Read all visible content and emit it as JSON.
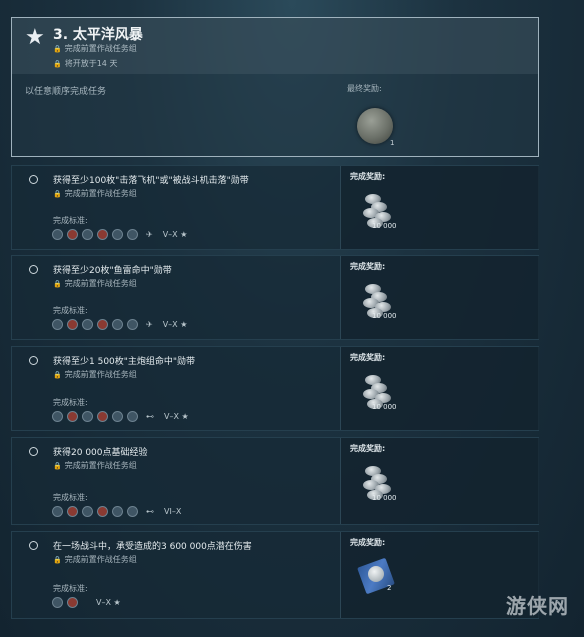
{
  "mission": {
    "title": "3. 太平洋风暴",
    "prereq": "完成前置作战任务组",
    "unlock": "将开放于14 天",
    "description": "以任意顺序完成任务",
    "final_reward_label": "最终奖励:",
    "final_reward_count": "1"
  },
  "tasks": [
    {
      "title": "获得至少100枚\"击落飞机\"或\"被战斗机击落\"勋带",
      "prereq": "完成前置作战任务组",
      "criteria_label": "完成标准:",
      "ship_class": "✈",
      "tier": "V–X ★",
      "reward_label": "完成奖励:",
      "reward_value": "10 000"
    },
    {
      "title": "获得至少20枚\"鱼雷命中\"勋带",
      "prereq": "完成前置作战任务组",
      "criteria_label": "完成标准:",
      "ship_class": "✈",
      "tier": "V–X ★",
      "reward_label": "完成奖励:",
      "reward_value": "10 000"
    },
    {
      "title": "获得至少1 500枚\"主炮组命中\"勋带",
      "prereq": "完成前置作战任务组",
      "criteria_label": "完成标准:",
      "ship_class": "⊷",
      "tier": "V–X ★",
      "reward_label": "完成奖励:",
      "reward_value": "10 000"
    },
    {
      "title": "获得20 000点基础经验",
      "prereq": "完成前置作战任务组",
      "criteria_label": "完成标准:",
      "ship_class": "⊷",
      "tier": "VI–X",
      "reward_label": "完成奖励:",
      "reward_value": "10 000"
    },
    {
      "title": "在一场战斗中，承受造成的3 600 000点潜在伤害",
      "prereq": "完成前置作战任务组",
      "criteria_label": "完成标准:",
      "ship_class": "",
      "tier": "V–X ★",
      "reward_label": "完成奖励:",
      "reward_value": "2"
    }
  ],
  "watermark": "游侠网",
  "colors": {
    "accent_red": "#8a3a32",
    "panel": "#162a36",
    "border_highlight": "#9fb2bd"
  }
}
